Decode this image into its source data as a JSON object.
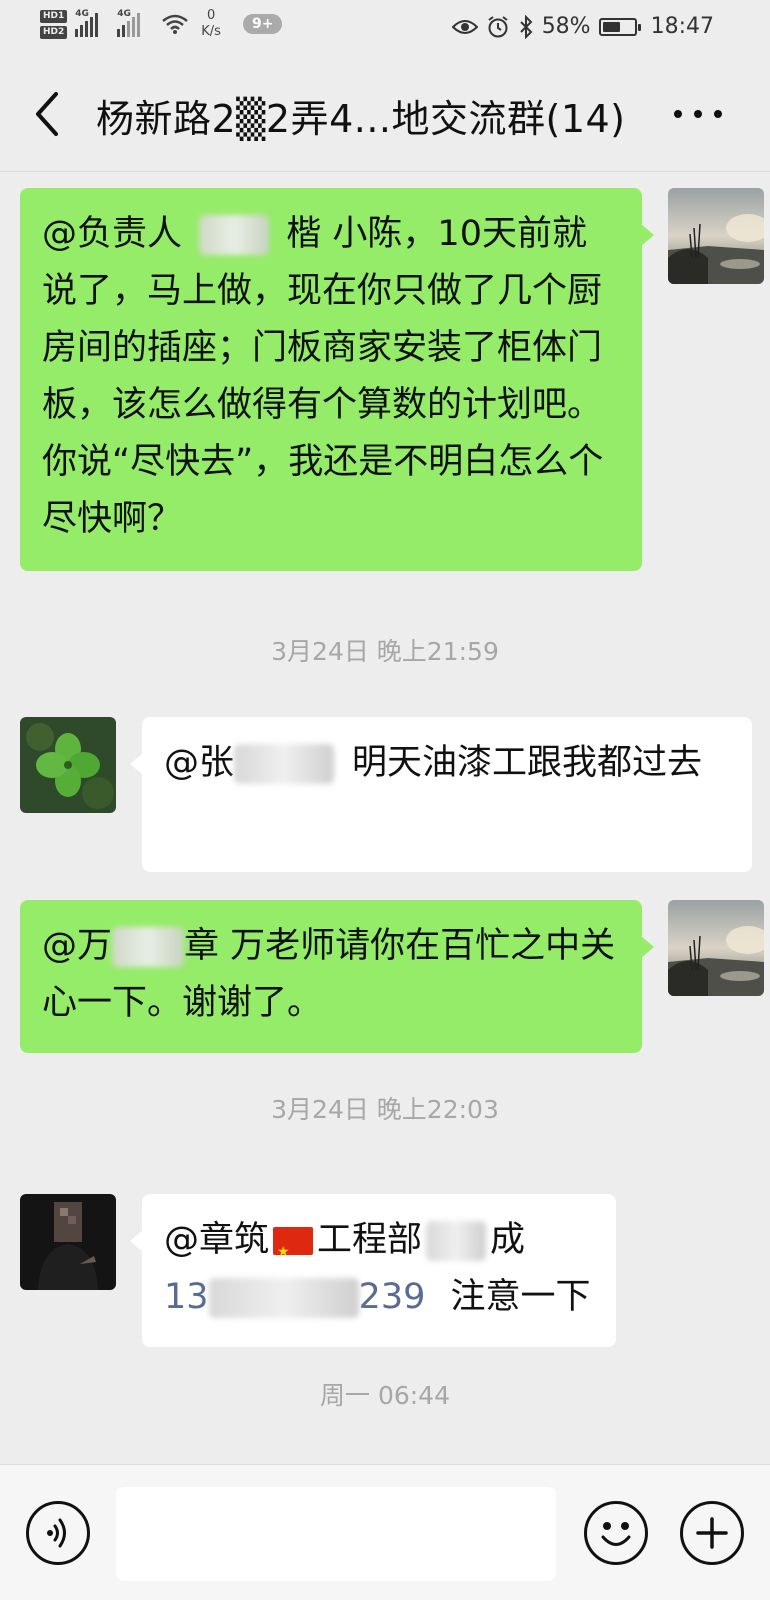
{
  "status_bar": {
    "hd1": "HD1",
    "hd2": "HD2",
    "sig1": "4G",
    "sig2": "4G",
    "speed_value": "0",
    "speed_unit": "K/s",
    "notifications": "9+",
    "battery": "58%",
    "battery_level": 0.58,
    "time": "18:47"
  },
  "header": {
    "title": "杨新路2▒2弄4...地交流群(14)"
  },
  "messages": {
    "m1": {
      "line1_a": "@负责人",
      "line1_b": "楷  小陈，10天前就",
      "rest": "说了，马上做，现在你只做了几个厨房间的插座；门板商家安装了柜体门板，该怎么做得有个算数的计划吧。你说“尽快去”，我还是不明白怎么个尽快啊？"
    },
    "ts1": "3月24日 晚上21:59",
    "m2": {
      "mention": "@张",
      "text": "明天油漆工跟我都过去"
    },
    "m3": {
      "mention": "@万",
      "text": "章  万老师请你在百忙之中关心一下。谢谢了。"
    },
    "ts2": "3月24日 晚上22:03",
    "m4": {
      "mention": "@章筑",
      "line1": "工程部",
      "line1_end": "成",
      "phone_start": "13",
      "phone_end": "239",
      "text": "注意一下"
    },
    "ts3": "周一 06:44"
  },
  "colors": {
    "bg": "#ededed",
    "sent_bubble": "#95ec69",
    "recv_bubble": "#ffffff",
    "link": "#576b95"
  }
}
